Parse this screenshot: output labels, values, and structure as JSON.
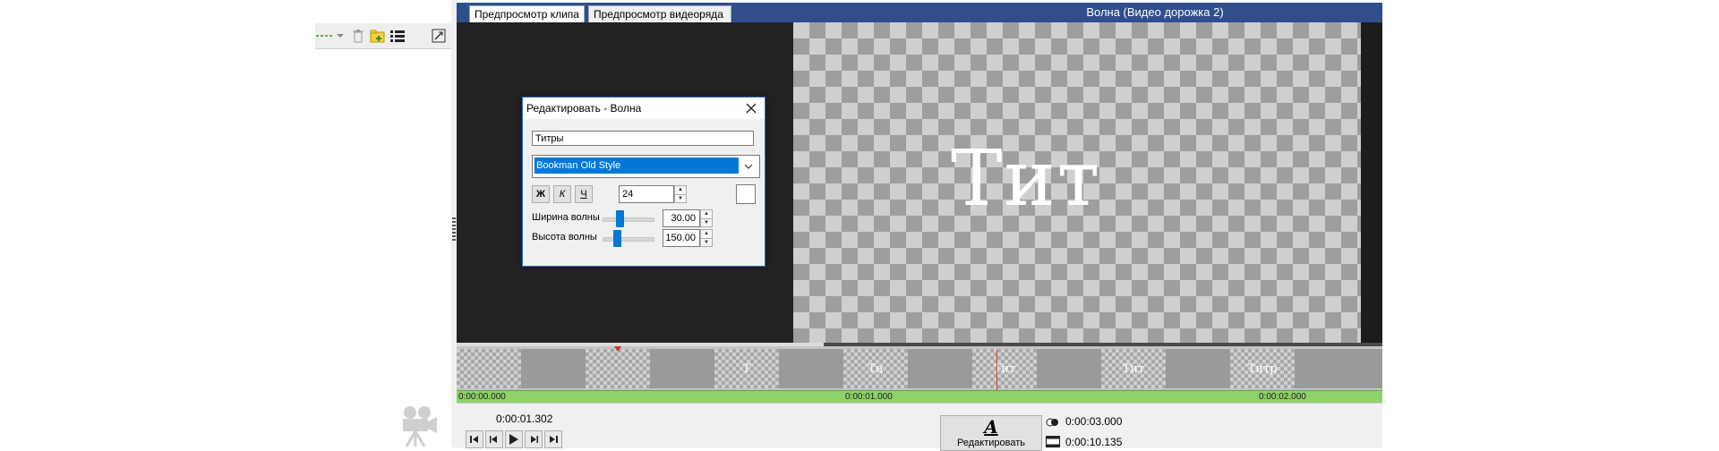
{
  "window": {
    "title": "Волна (Видео дорожка 2)",
    "tabs": [
      {
        "label": "Предпросмотр клипа",
        "active": true
      },
      {
        "label": "Предпросмотр видеоряда",
        "active": false
      }
    ]
  },
  "left_toolbar": {
    "icons": [
      "dropdown-icon",
      "trash-icon",
      "add-folder-icon",
      "list-icon",
      "fit-icon"
    ]
  },
  "preview": {
    "title_text": "Тит"
  },
  "dialog": {
    "title": "Редактировать - Волна",
    "text_value": "Титры",
    "font_value": "Bookman Old Style",
    "bold_label": "Ж",
    "italic_label": "К",
    "underline_label": "Ч",
    "size_value": "24",
    "wave_width_label": "Ширина волны",
    "wave_width_value": "30.00",
    "wave_height_label": "Высота волны",
    "wave_height_value": "150.00"
  },
  "timeline": {
    "thumb_labels": [
      "",
      "",
      "Т",
      "Ти",
      "Тит",
      "Тит",
      "Титр"
    ],
    "ruler": [
      "0:00:00.000",
      "0:00:01.000",
      "0:00:02.000"
    ]
  },
  "controls": {
    "current_time": "0:00:01.302",
    "edit_label": "Редактировать",
    "edit_icon_letter": "A",
    "duration": "0:00:03.000",
    "total": "0:00:10.135"
  },
  "colors": {
    "title_bar": "#2f4e8c",
    "accent": "#0078d7",
    "ruler": "#8fd16a",
    "playhead": "#d63b2b"
  }
}
